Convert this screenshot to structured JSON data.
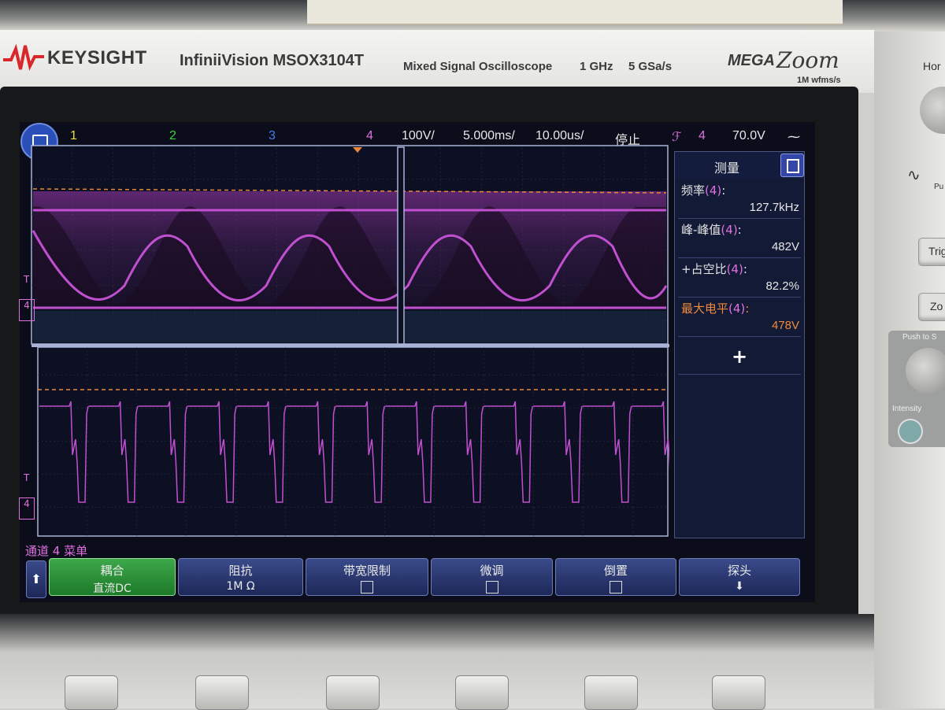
{
  "brand": {
    "name": "KEYSIGHT",
    "model": "InfiniiVision MSOX3104T",
    "description": "Mixed Signal Oscilloscope",
    "bandwidth": "1 GHz",
    "sample_rate": "5 GSa/s",
    "megazoom_mega": "MEGA",
    "megazoom_zoom": "Zoom",
    "megazoom_sub": "1M wfms/s"
  },
  "status_bar": {
    "ch1": "1",
    "ch2": "2",
    "ch3": "3",
    "ch4": "4",
    "volts_per_div": "100V/",
    "time_per_div": "5.000ms/",
    "zoom_time_per_div": "10.00us/",
    "run_state": "停止",
    "trigger_channel": "4",
    "trigger_level": "70.0V"
  },
  "colors": {
    "ch1": "#e6e03c",
    "ch2": "#3cd23c",
    "ch3": "#4a7cf0",
    "ch4": "#e070e0",
    "trigger_line": "#e8883a"
  },
  "measurements": {
    "title": "测量",
    "items": [
      {
        "label": "频率",
        "channel": "(4)",
        "suffix": ":",
        "value": "127.7kHz",
        "color": "#e6e6e6"
      },
      {
        "label": "峰-峰值",
        "channel": "(4)",
        "suffix": ":",
        "value": "482V",
        "color": "#e6e6e6"
      },
      {
        "label": "+占空比",
        "channel": "(4)",
        "suffix": ":",
        "value": "82.2%",
        "color": "#e6e6e6"
      },
      {
        "label": "最大电平",
        "channel": "(4)",
        "suffix": ":",
        "value": "478V",
        "color": "#f08a3c"
      }
    ],
    "add": "+"
  },
  "channel_menu": {
    "title": "通道 4 菜单",
    "softkeys": [
      {
        "label": "耦合",
        "value": "直流DC"
      },
      {
        "label": "阻抗",
        "value": "1M Ω"
      },
      {
        "label": "带宽限制",
        "value": ""
      },
      {
        "label": "微调",
        "value": ""
      },
      {
        "label": "倒置",
        "value": ""
      },
      {
        "label": "探头",
        "value": ""
      }
    ]
  },
  "ground_marker": "4",
  "trigger_marker": "T",
  "right_panel": {
    "hori": "Hor",
    "trig": "Trig",
    "zoom": "Zo",
    "push": "Push to S",
    "intensity": "Intensity",
    "pu": "Pu"
  }
}
